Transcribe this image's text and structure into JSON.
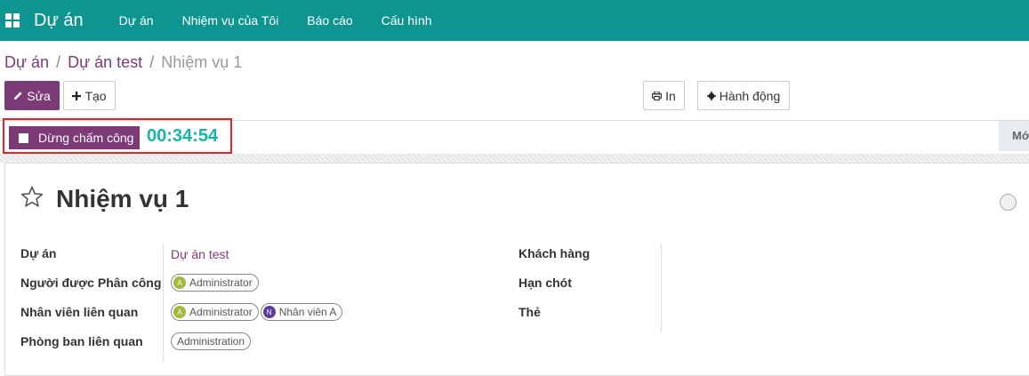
{
  "navbar": {
    "brand": "Dự án",
    "items": [
      {
        "label": "Dự án"
      },
      {
        "label": "Nhiệm vụ của Tôi"
      },
      {
        "label": "Báo cáo"
      },
      {
        "label": "Cấu hình"
      }
    ]
  },
  "breadcrumb": {
    "root": "Dự án",
    "project": "Dự án test",
    "current": "Nhiệm vụ 1"
  },
  "buttons": {
    "edit": "Sửa",
    "create": "Tạo",
    "print": "In",
    "action": "Hành động"
  },
  "timer": {
    "stop_label": "Dừng chấm công",
    "elapsed": "00:34:54"
  },
  "stage": {
    "partial_label": "Mới"
  },
  "task": {
    "title": "Nhiệm vụ 1",
    "fields": {
      "project_label": "Dự án",
      "project_value": "Dự án test",
      "assignee_label": "Người được Phân công",
      "assignees": [
        {
          "initial": "A",
          "name": "Administrator",
          "color": "#a2b93b"
        }
      ],
      "followers_label": "Nhân viên liên quan",
      "followers": [
        {
          "initial": "A",
          "name": "Administrator",
          "color": "#a2b93b"
        },
        {
          "initial": "N",
          "name": "Nhân viên A",
          "color": "#5a3da0"
        }
      ],
      "department_label": "Phòng ban liên quan",
      "departments": [
        {
          "name": "Administration"
        }
      ],
      "customer_label": "Khách hàng",
      "deadline_label": "Hạn chót",
      "tags_label": "Thẻ"
    }
  },
  "colors": {
    "navbar": "#0e9591",
    "primary": "#7c3a77",
    "timer": "#15b6a9",
    "highlight": "#e32525"
  }
}
